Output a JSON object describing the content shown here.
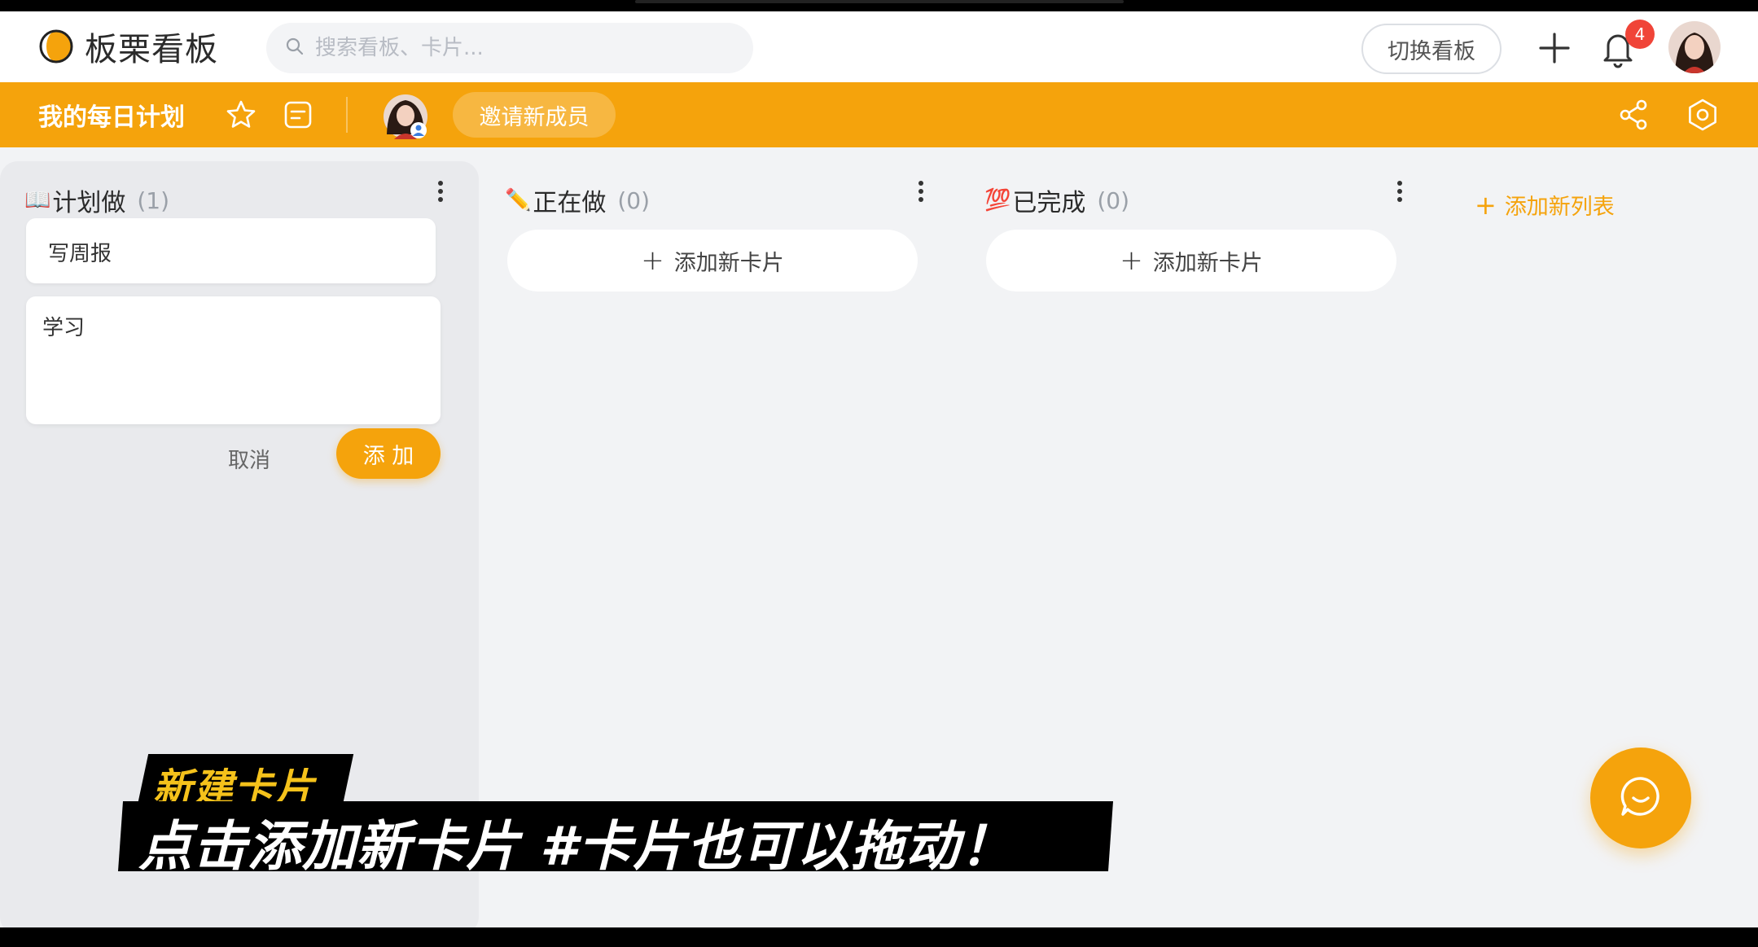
{
  "app": {
    "name": "板栗看板"
  },
  "search": {
    "placeholder": "搜索看板、卡片..."
  },
  "header": {
    "switch_board_label": "切换看板",
    "notification_count": "4"
  },
  "board": {
    "title": "我的每日计划",
    "invite_label": "邀请新成员"
  },
  "columns": [
    {
      "emoji": "📖",
      "title": "计划做",
      "count": "(1)",
      "cards": [
        {
          "text": "写周报"
        }
      ],
      "editor_value": "学习",
      "cancel_label": "取消",
      "add_label": "添 加"
    },
    {
      "emoji": "✏️",
      "title": "正在做",
      "count": "(0)",
      "add_card_label": "添加新卡片"
    },
    {
      "emoji": "💯",
      "title": "已完成",
      "count": "(0)",
      "add_card_label": "添加新卡片"
    }
  ],
  "add_list_label": "添加新列表",
  "overlay": {
    "tag": "新建卡片",
    "caption": "点击添加新卡片 #卡片也可以拖动！"
  },
  "colors": {
    "accent": "#f5a30c",
    "badge": "#f04438",
    "background": "#f2f3f5"
  },
  "icons": [
    "search-icon",
    "plus-icon",
    "bell-icon",
    "star-icon",
    "list-icon",
    "share-icon",
    "settings-icon",
    "chat-icon",
    "more-icon"
  ]
}
